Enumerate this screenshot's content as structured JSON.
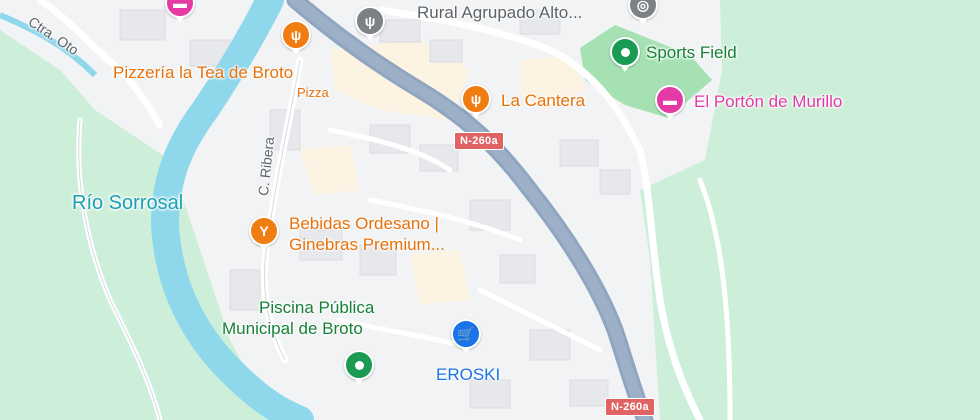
{
  "map": {
    "colors": {
      "land": "#cdefd9",
      "urban": "#f1f3f4",
      "building": "#e6e8eb",
      "commercial": "#fdf3e2",
      "river": "#8fd8ec",
      "highway": "#8fa5c0",
      "road": "#ffffff",
      "sports_field": "#a6e1b4"
    },
    "labels": {
      "ctra_oto": "Ctra. Oto",
      "rural_agrupado": "Rural Agrupado Alto...",
      "pizzeria_name": "Pizzería la Tea de Broto",
      "pizzeria_category": "Pizza",
      "la_cantera": "La Cantera",
      "sports_field": "Sports Field",
      "el_porton": "El Portón de Murillo",
      "rio_sorrosal": "Río Sorrosal",
      "c_ribera": "C. Ribera",
      "bebidas_line1": "Bebidas Ordesano |",
      "bebidas_line2": "Ginebras Premium...",
      "piscina_line1": "Piscina Pública",
      "piscina_line2": "Municipal de Broto",
      "eroski": "EROSKI"
    },
    "road_shields": {
      "n260a_top": "N-260a",
      "n260a_bottom": "N-260a"
    },
    "icons": {
      "pizzeria": "restaurant-icon",
      "la_cantera": "restaurant-icon",
      "top_restaurant": "restaurant-icon",
      "top_hotel": "hotel-icon",
      "el_porton": "hotel-icon",
      "sports_field": "park-icon",
      "piscina": "park-icon",
      "bebidas": "bar-icon",
      "eroski": "shopping-cart-icon",
      "rural_agrupado": "landmark-icon"
    }
  }
}
